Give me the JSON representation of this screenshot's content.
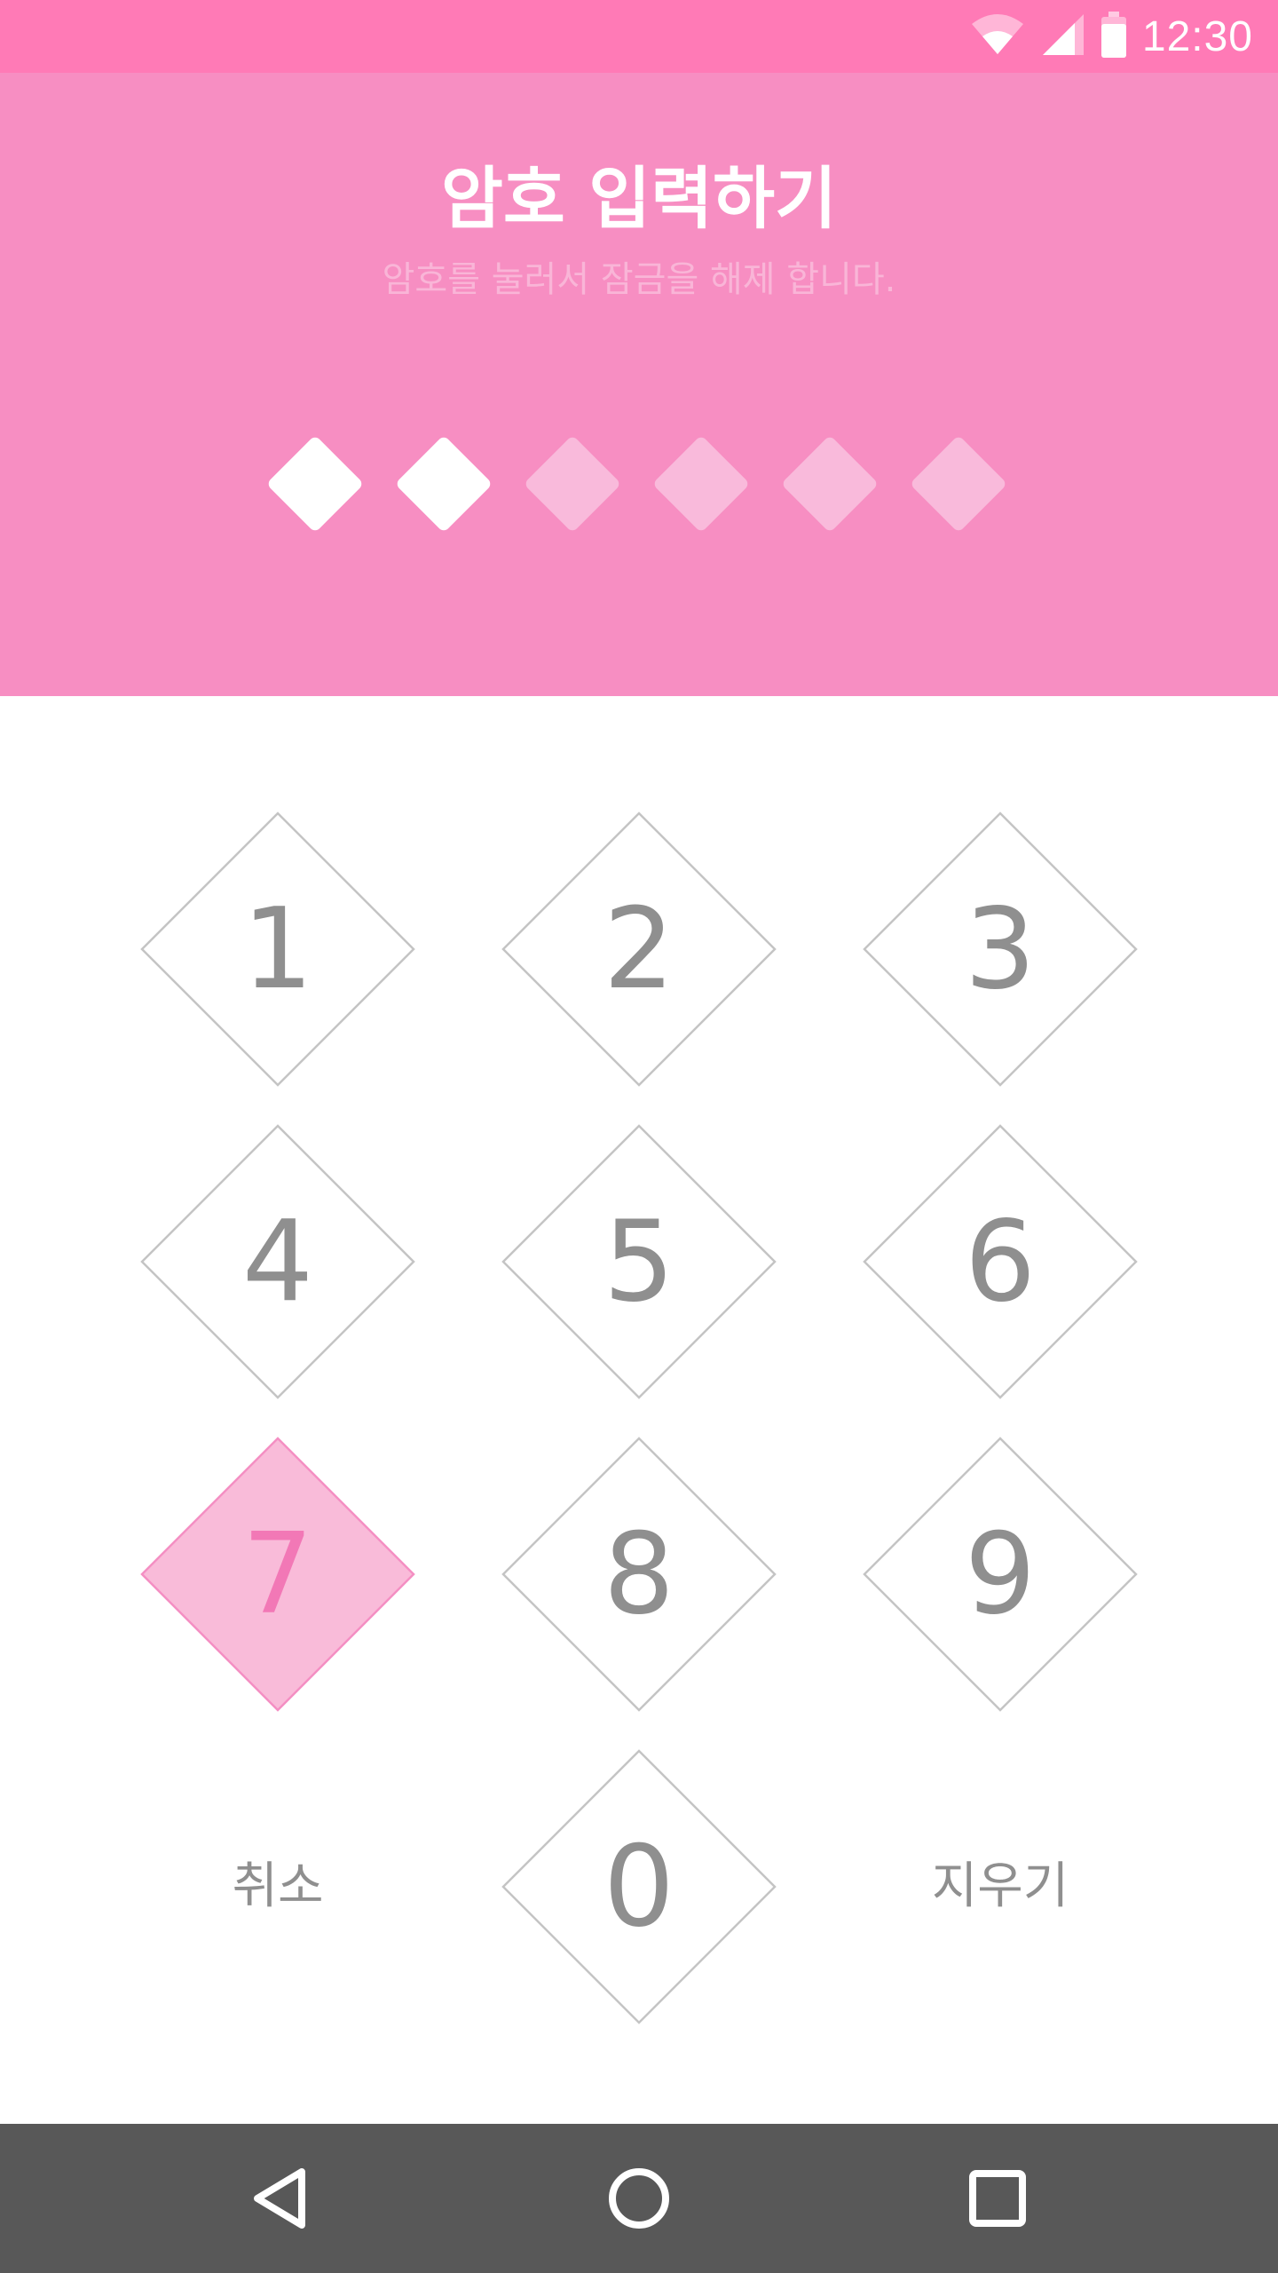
{
  "status_bar": {
    "time": "12:30",
    "icons": [
      "wifi-icon",
      "cell-signal-icon",
      "battery-icon"
    ],
    "color": "#ff7ab6"
  },
  "header": {
    "title": "암호 입력하기",
    "subtitle": "암호를 눌러서 잠금을 해제 합니다.",
    "color": "#f78ec2"
  },
  "pin": {
    "length": 6,
    "entered": 2
  },
  "keypad": {
    "keys": [
      "1",
      "2",
      "3",
      "4",
      "5",
      "6",
      "7",
      "8",
      "9",
      "0"
    ],
    "pressed_key": "7",
    "cancel_label": "취소",
    "delete_label": "지우기",
    "accent_color": "#f278b6"
  },
  "nav_bar": {
    "icons": [
      "back-icon",
      "home-icon",
      "recents-icon"
    ]
  }
}
